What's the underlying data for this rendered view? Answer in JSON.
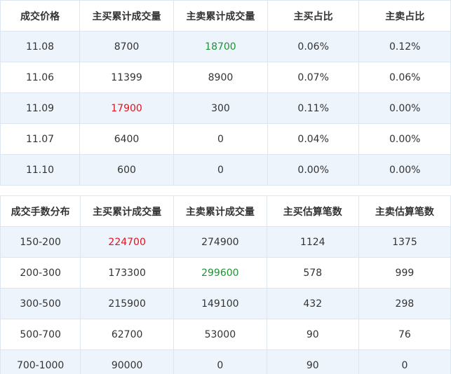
{
  "price_table": {
    "headers": [
      "成交价格",
      "主买累计成交量",
      "主卖累计成交量",
      "主买占比",
      "主卖占比"
    ],
    "rows": [
      [
        "11.08",
        "8700",
        "18700",
        "0.06%",
        "0.12%"
      ],
      [
        "11.06",
        "11399",
        "8900",
        "0.07%",
        "0.06%"
      ],
      [
        "11.09",
        "17900",
        "300",
        "0.11%",
        "0.00%"
      ],
      [
        "11.07",
        "6400",
        "0",
        "0.04%",
        "0.00%"
      ],
      [
        "11.10",
        "600",
        "0",
        "0.00%",
        "0.00%"
      ]
    ]
  },
  "lot_table": {
    "headers": [
      "成交手数分布",
      "主买累计成交量",
      "主卖累计成交量",
      "主买估算笔数",
      "主卖估算笔数"
    ],
    "rows": [
      [
        "150-200",
        "224700",
        "274900",
        "1124",
        "1375"
      ],
      [
        "200-300",
        "173300",
        "299600",
        "578",
        "999"
      ],
      [
        "300-500",
        "215900",
        "149100",
        "432",
        "298"
      ],
      [
        "500-700",
        "62700",
        "53000",
        "90",
        "76"
      ],
      [
        "700-1000",
        "90000",
        "0",
        "90",
        "0"
      ]
    ]
  },
  "colors": {
    "row_shade": "#eef4fc",
    "border": "#dde6ee",
    "highlight_red": "#e8101b",
    "highlight_green": "#1a9531"
  }
}
